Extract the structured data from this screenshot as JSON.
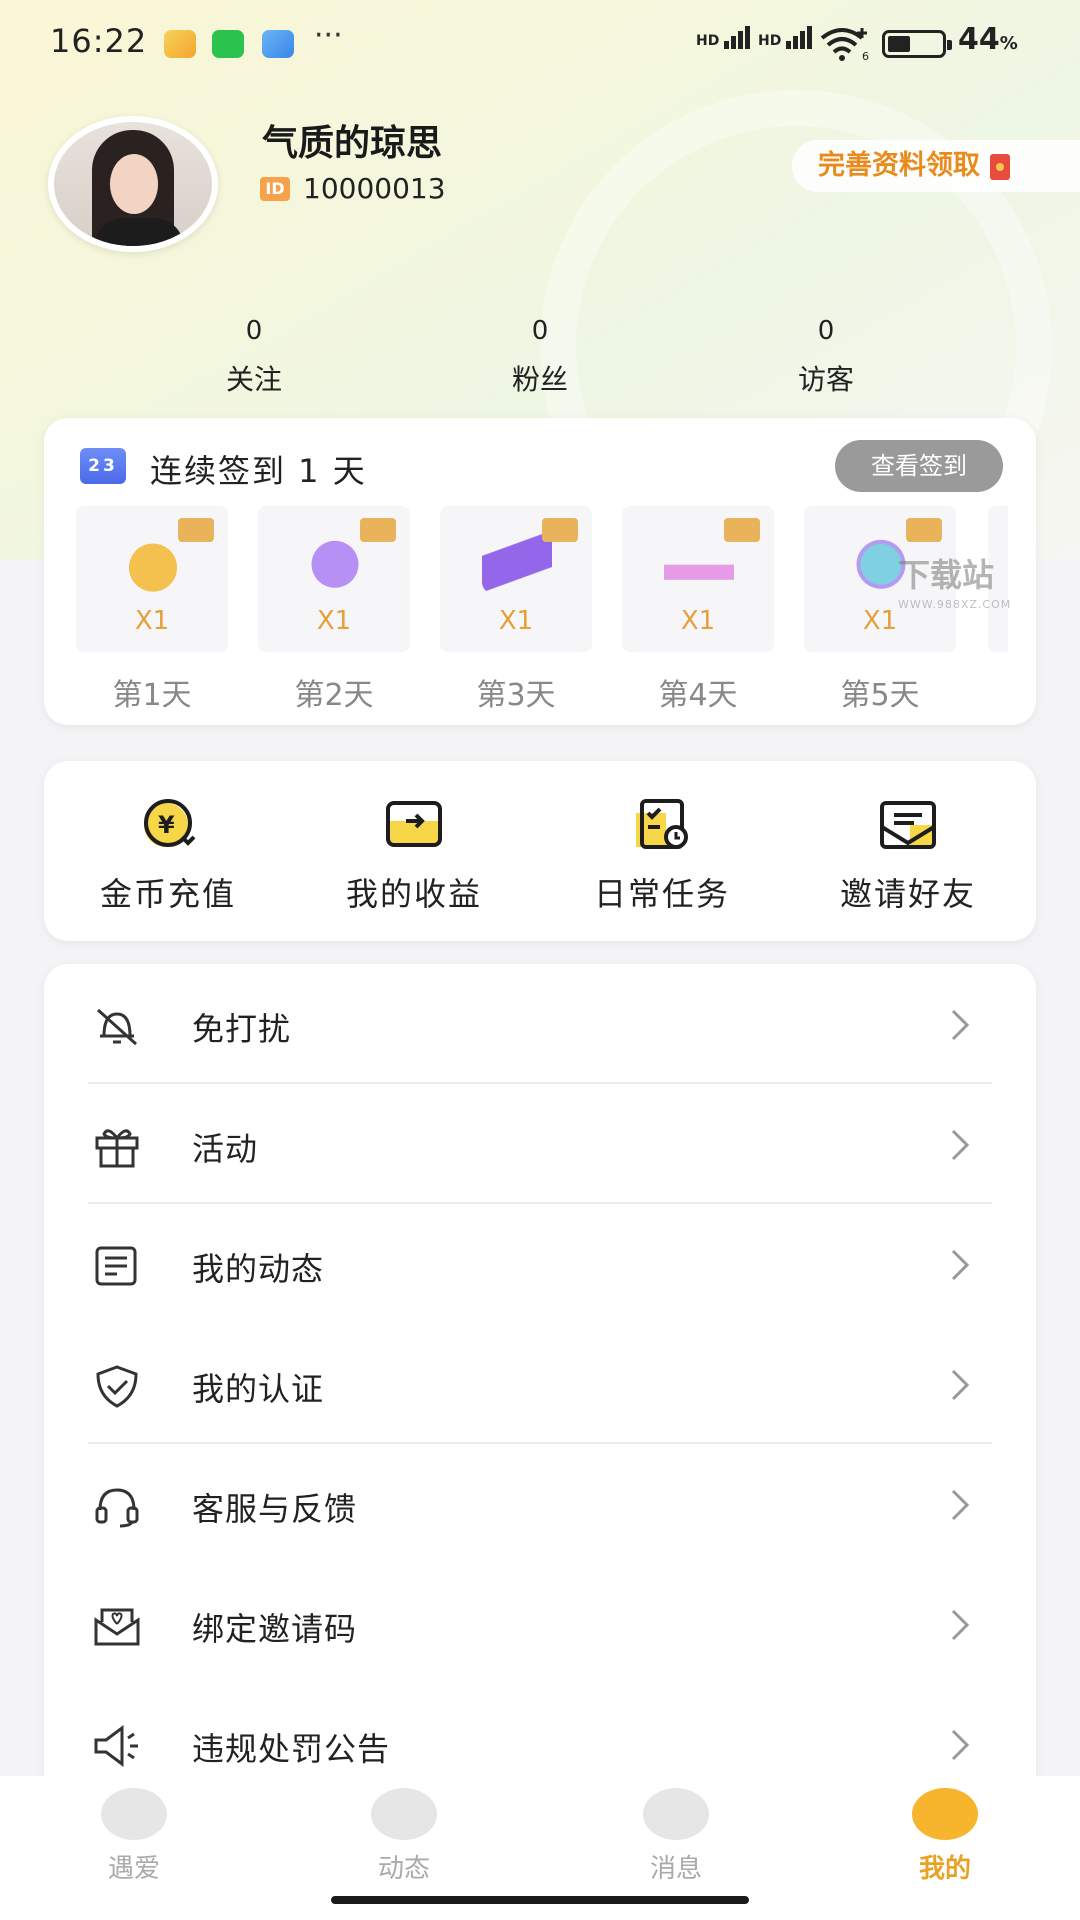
{
  "status_bar": {
    "time": "16:22",
    "signal1": "HD",
    "signal2": "HD",
    "wifi_badge": "6",
    "battery": "44",
    "battery_unit": "%"
  },
  "profile": {
    "nickname": "气质的琼思",
    "id_badge": "ID",
    "id_number": "10000013",
    "complete_button": "完善资料领取"
  },
  "stats": [
    {
      "value": "0",
      "label": "关注"
    },
    {
      "value": "0",
      "label": "粉丝"
    },
    {
      "value": "0",
      "label": "访客"
    }
  ],
  "sign_in": {
    "calendar_icon_text": "23",
    "title": "连续签到 1 天",
    "view_button": "查看签到",
    "days": [
      {
        "multiplier": "X1",
        "label": "第1天",
        "gift": "crown",
        "color": "#f0b23a"
      },
      {
        "multiplier": "X1",
        "label": "第2天",
        "gift": "bear",
        "color": "#a57bf3"
      },
      {
        "multiplier": "X1",
        "label": "第3天",
        "gift": "ticket",
        "color": "#8a5ce6"
      },
      {
        "multiplier": "X1",
        "label": "第4天",
        "gift": "badge",
        "color": "#e59be6"
      },
      {
        "multiplier": "X1",
        "label": "第5天",
        "gift": "globe",
        "color": "#6fc6d9"
      }
    ]
  },
  "watermark": {
    "main": "下载站",
    "sub": "WWW.988XZ.COM"
  },
  "quick_actions": [
    {
      "label": "金币充值",
      "icon": "coin-recharge-icon"
    },
    {
      "label": "我的收益",
      "icon": "wallet-icon"
    },
    {
      "label": "日常任务",
      "icon": "task-icon"
    },
    {
      "label": "邀请好友",
      "icon": "invite-mail-icon"
    }
  ],
  "menu": [
    {
      "label": "免打扰",
      "icon": "bell-off-icon"
    },
    {
      "label": "活动",
      "icon": "gift-icon"
    },
    {
      "label": "我的动态",
      "icon": "feed-icon"
    },
    {
      "label": "我的认证",
      "icon": "shield-check-icon"
    },
    {
      "label": "客服与反馈",
      "icon": "headset-icon"
    },
    {
      "label": "绑定邀请码",
      "icon": "invite-code-icon"
    },
    {
      "label": "违规处罚公告",
      "icon": "megaphone-icon"
    }
  ],
  "tabs": [
    {
      "label": "遇爱",
      "active": false
    },
    {
      "label": "动态",
      "active": false
    },
    {
      "label": "消息",
      "active": false
    },
    {
      "label": "我的",
      "active": true
    }
  ],
  "colors": {
    "accent": "#f7b52e",
    "accent_text": "#e9a324",
    "gold_text": "#e6a03a"
  }
}
